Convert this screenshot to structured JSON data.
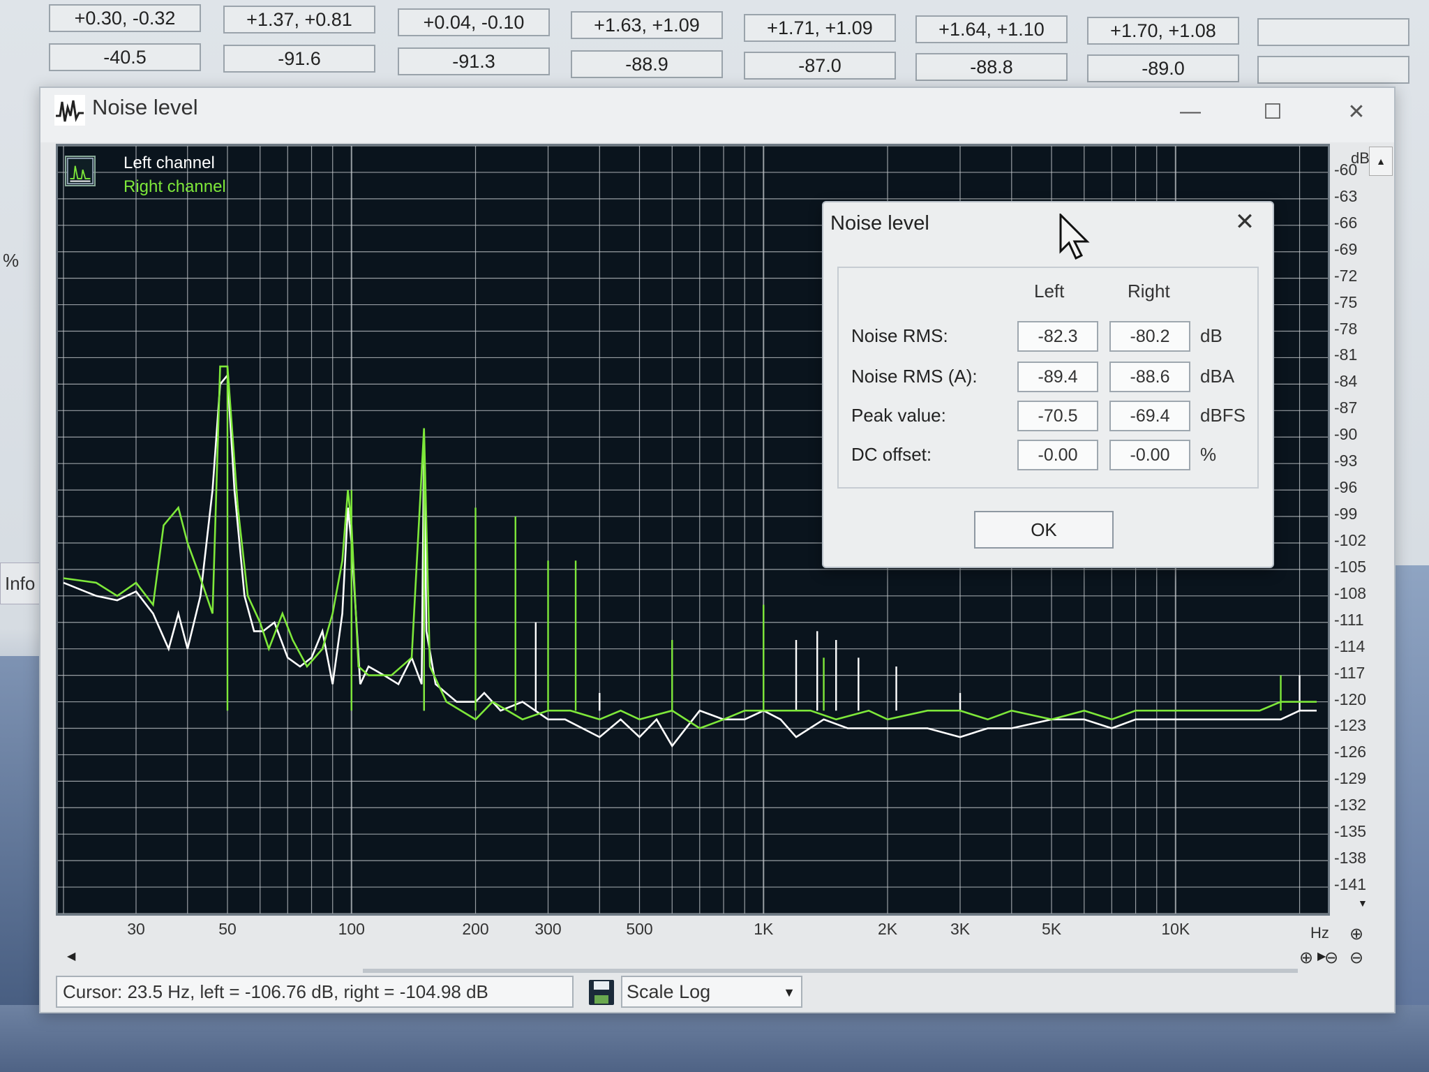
{
  "background": {
    "table_top_row": [
      "+0.30, -0.32",
      "+1.37, +0.81",
      "+0.04, -0.10",
      "+1.63, +1.09",
      "+1.71, +1.09",
      "+1.64, +1.10",
      "+1.70, +1.08",
      ""
    ],
    "table_bottom_row": [
      "-40.5",
      "-91.6",
      "-91.3",
      "-88.9",
      "-87.0",
      "-88.8",
      "-89.0",
      ""
    ],
    "side_percent": "%",
    "side_info": "Info"
  },
  "window": {
    "title": "Noise level",
    "minimize": "—",
    "maximize": "☐",
    "close": "✕"
  },
  "plot": {
    "legend_left": "Left channel",
    "legend_right": "Right channel",
    "y_unit": "dB",
    "x_unit": "Hz",
    "colors": {
      "background": "#0a141d",
      "grid": "#c8ccd0",
      "left_channel": "#ffffff",
      "right_channel": "#7ee83a"
    }
  },
  "chart_data": {
    "type": "line",
    "x_scale": "log",
    "xlim": [
      20,
      22000
    ],
    "ylim": [
      -144,
      -57
    ],
    "y_ticks": [
      -60,
      -63,
      -66,
      -69,
      -72,
      -75,
      -78,
      -81,
      -84,
      -87,
      -90,
      -93,
      -96,
      -99,
      -102,
      -105,
      -108,
      -111,
      -114,
      -117,
      -120,
      -123,
      -126,
      -129,
      -132,
      -135,
      -138,
      -141
    ],
    "x_ticks": [
      {
        "value": 30,
        "label": "30"
      },
      {
        "value": 50,
        "label": "50"
      },
      {
        "value": 100,
        "label": "100"
      },
      {
        "value": 200,
        "label": "200"
      },
      {
        "value": 300,
        "label": "300"
      },
      {
        "value": 500,
        "label": "500"
      },
      {
        "value": 1000,
        "label": "1K"
      },
      {
        "value": 2000,
        "label": "2K"
      },
      {
        "value": 3000,
        "label": "3K"
      },
      {
        "value": 5000,
        "label": "5K"
      },
      {
        "value": 10000,
        "label": "10K"
      }
    ],
    "grid": true,
    "series": [
      {
        "name": "Left channel",
        "points": [
          [
            20,
            -106.5
          ],
          [
            24,
            -108
          ],
          [
            27,
            -108.5
          ],
          [
            30,
            -107.5
          ],
          [
            33,
            -110
          ],
          [
            36,
            -114
          ],
          [
            38,
            -110
          ],
          [
            40,
            -114
          ],
          [
            43,
            -108
          ],
          [
            46,
            -96
          ],
          [
            48,
            -84
          ],
          [
            50,
            -83
          ],
          [
            52,
            -96
          ],
          [
            55,
            -108
          ],
          [
            58,
            -112
          ],
          [
            61,
            -112
          ],
          [
            65,
            -111
          ],
          [
            70,
            -115
          ],
          [
            75,
            -116
          ],
          [
            80,
            -115
          ],
          [
            85,
            -112
          ],
          [
            90,
            -118
          ],
          [
            95,
            -110
          ],
          [
            98,
            -98
          ],
          [
            100,
            -102
          ],
          [
            105,
            -118
          ],
          [
            110,
            -116
          ],
          [
            120,
            -117
          ],
          [
            130,
            -118
          ],
          [
            140,
            -115
          ],
          [
            148,
            -118
          ],
          [
            150,
            -90
          ],
          [
            152,
            -112
          ],
          [
            160,
            -118
          ],
          [
            180,
            -120
          ],
          [
            200,
            -120
          ],
          [
            210,
            -119
          ],
          [
            230,
            -121
          ],
          [
            260,
            -120
          ],
          [
            300,
            -122
          ],
          [
            330,
            -122
          ],
          [
            400,
            -124
          ],
          [
            450,
            -122
          ],
          [
            500,
            -124
          ],
          [
            550,
            -122
          ],
          [
            600,
            -125
          ],
          [
            700,
            -121
          ],
          [
            800,
            -122
          ],
          [
            900,
            -122
          ],
          [
            1000,
            -121
          ],
          [
            1100,
            -122
          ],
          [
            1200,
            -124
          ],
          [
            1400,
            -122
          ],
          [
            1600,
            -123
          ],
          [
            1800,
            -123
          ],
          [
            2000,
            -123
          ],
          [
            2500,
            -123
          ],
          [
            3000,
            -124
          ],
          [
            3500,
            -123
          ],
          [
            4000,
            -123
          ],
          [
            5000,
            -122
          ],
          [
            6000,
            -122
          ],
          [
            7000,
            -123
          ],
          [
            8000,
            -122
          ],
          [
            10000,
            -122
          ],
          [
            12000,
            -122
          ],
          [
            14000,
            -122
          ],
          [
            16000,
            -122
          ],
          [
            18000,
            -122
          ],
          [
            20000,
            -121
          ],
          [
            22000,
            -121
          ]
        ],
        "spikes": [
          [
            150,
            -90
          ],
          [
            280,
            -111
          ],
          [
            400,
            -119
          ],
          [
            1200,
            -113
          ],
          [
            1350,
            -112
          ],
          [
            1500,
            -113
          ],
          [
            1700,
            -115
          ],
          [
            2100,
            -116
          ],
          [
            3000,
            -119
          ],
          [
            20000,
            -117
          ]
        ]
      },
      {
        "name": "Right channel",
        "points": [
          [
            20,
            -106
          ],
          [
            24,
            -106.5
          ],
          [
            27,
            -108
          ],
          [
            30,
            -106.5
          ],
          [
            33,
            -109
          ],
          [
            35,
            -100
          ],
          [
            38,
            -98
          ],
          [
            40,
            -102
          ],
          [
            43,
            -106
          ],
          [
            46,
            -110
          ],
          [
            48,
            -82
          ],
          [
            50,
            -82
          ],
          [
            53,
            -98
          ],
          [
            56,
            -108
          ],
          [
            60,
            -111
          ],
          [
            63,
            -114
          ],
          [
            68,
            -110
          ],
          [
            72,
            -113
          ],
          [
            78,
            -116
          ],
          [
            85,
            -114
          ],
          [
            90,
            -110
          ],
          [
            95,
            -104
          ],
          [
            98,
            -96
          ],
          [
            100,
            -100
          ],
          [
            104,
            -116
          ],
          [
            110,
            -117
          ],
          [
            125,
            -117
          ],
          [
            140,
            -115
          ],
          [
            150,
            -89
          ],
          [
            155,
            -116
          ],
          [
            170,
            -120
          ],
          [
            200,
            -122
          ],
          [
            220,
            -120
          ],
          [
            260,
            -122
          ],
          [
            300,
            -121
          ],
          [
            340,
            -121
          ],
          [
            400,
            -122
          ],
          [
            450,
            -121
          ],
          [
            500,
            -122
          ],
          [
            600,
            -121
          ],
          [
            700,
            -123
          ],
          [
            800,
            -122
          ],
          [
            900,
            -121
          ],
          [
            1000,
            -121
          ],
          [
            1100,
            -121
          ],
          [
            1300,
            -121
          ],
          [
            1500,
            -122
          ],
          [
            1800,
            -121
          ],
          [
            2000,
            -122
          ],
          [
            2500,
            -121
          ],
          [
            3000,
            -121
          ],
          [
            3500,
            -122
          ],
          [
            4000,
            -121
          ],
          [
            5000,
            -122
          ],
          [
            6000,
            -121
          ],
          [
            7000,
            -122
          ],
          [
            8000,
            -121
          ],
          [
            10000,
            -121
          ],
          [
            12000,
            -121
          ],
          [
            14000,
            -121
          ],
          [
            16000,
            -121
          ],
          [
            18000,
            -120
          ],
          [
            20000,
            -120
          ],
          [
            22000,
            -120
          ]
        ],
        "spikes": [
          [
            50,
            -82
          ],
          [
            100,
            -96
          ],
          [
            150,
            -89
          ],
          [
            200,
            -98
          ],
          [
            250,
            -99
          ],
          [
            300,
            -104
          ],
          [
            350,
            -104
          ],
          [
            600,
            -113
          ],
          [
            1000,
            -109
          ],
          [
            1400,
            -115
          ],
          [
            18000,
            -117
          ]
        ]
      }
    ]
  },
  "status": {
    "cursor": "Cursor: 23.5 Hz, left = -106.76 dB, right = -104.98 dB",
    "scale_prefix": "Scale",
    "scale_value": "Log"
  },
  "dialog": {
    "title": "Noise level",
    "close": "✕",
    "col_left": "Left",
    "col_right": "Right",
    "rows": [
      {
        "label": "Noise RMS:",
        "left": "-82.3",
        "right": "-80.2",
        "unit": "dB"
      },
      {
        "label": "Noise RMS (A):",
        "left": "-89.4",
        "right": "-88.6",
        "unit": "dBA"
      },
      {
        "label": "Peak value:",
        "left": "-70.5",
        "right": "-69.4",
        "unit": "dBFS"
      },
      {
        "label": "DC offset:",
        "left": "-0.00",
        "right": "-0.00",
        "unit": "%"
      }
    ],
    "ok": "OK"
  }
}
